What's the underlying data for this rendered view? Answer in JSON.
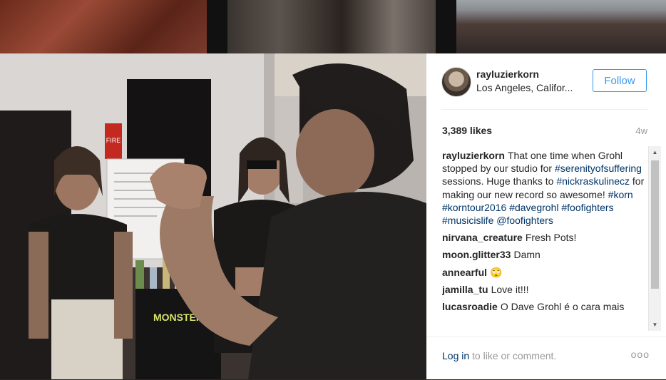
{
  "post": {
    "username": "rayluzierkorn",
    "location": "Los Angeles, Califor...",
    "follow_label": "Follow",
    "likes": "3,389 likes",
    "time": "4w"
  },
  "comments": [
    {
      "user": "rayluzierkorn",
      "parts": [
        {
          "t": "That one time when Grohl stopped by our studio for ",
          "tag": false
        },
        {
          "t": "#serenityofsuffering",
          "tag": true
        },
        {
          "t": " sessions. Huge thanks to ",
          "tag": false
        },
        {
          "t": "#nickraskulinecz",
          "tag": true
        },
        {
          "t": " for making our new record so awesome! ",
          "tag": false
        },
        {
          "t": "#korn",
          "tag": true
        },
        {
          "t": " ",
          "tag": false
        },
        {
          "t": "#korntour2016",
          "tag": true
        },
        {
          "t": " ",
          "tag": false
        },
        {
          "t": "#davegrohl",
          "tag": true
        },
        {
          "t": " ",
          "tag": false
        },
        {
          "t": "#foofighters",
          "tag": true
        },
        {
          "t": " ",
          "tag": false
        },
        {
          "t": "#musicislife",
          "tag": true
        },
        {
          "t": " ",
          "tag": false
        },
        {
          "t": "@foofighters",
          "tag": true
        }
      ]
    },
    {
      "user": "nirvana_creature",
      "parts": [
        {
          "t": "Fresh Pots!",
          "tag": false
        }
      ]
    },
    {
      "user": "moon.glitter33",
      "parts": [
        {
          "t": "Damn",
          "tag": false
        }
      ]
    },
    {
      "user": "annearful",
      "parts": [
        {
          "t": "🙄",
          "tag": false
        }
      ]
    },
    {
      "user": "jamilla_tu",
      "parts": [
        {
          "t": "Love it!!!",
          "tag": false
        }
      ]
    },
    {
      "user": "lucasroadie",
      "parts": [
        {
          "t": "O Dave Grohl é o cara mais",
          "tag": false
        }
      ]
    }
  ],
  "footer": {
    "login_link": "Log in",
    "login_rest": " to like or comment.",
    "more_glyph": "ooo"
  },
  "photo": {
    "sign_text": "FIRE",
    "fridge_brand": "MONSTER"
  }
}
